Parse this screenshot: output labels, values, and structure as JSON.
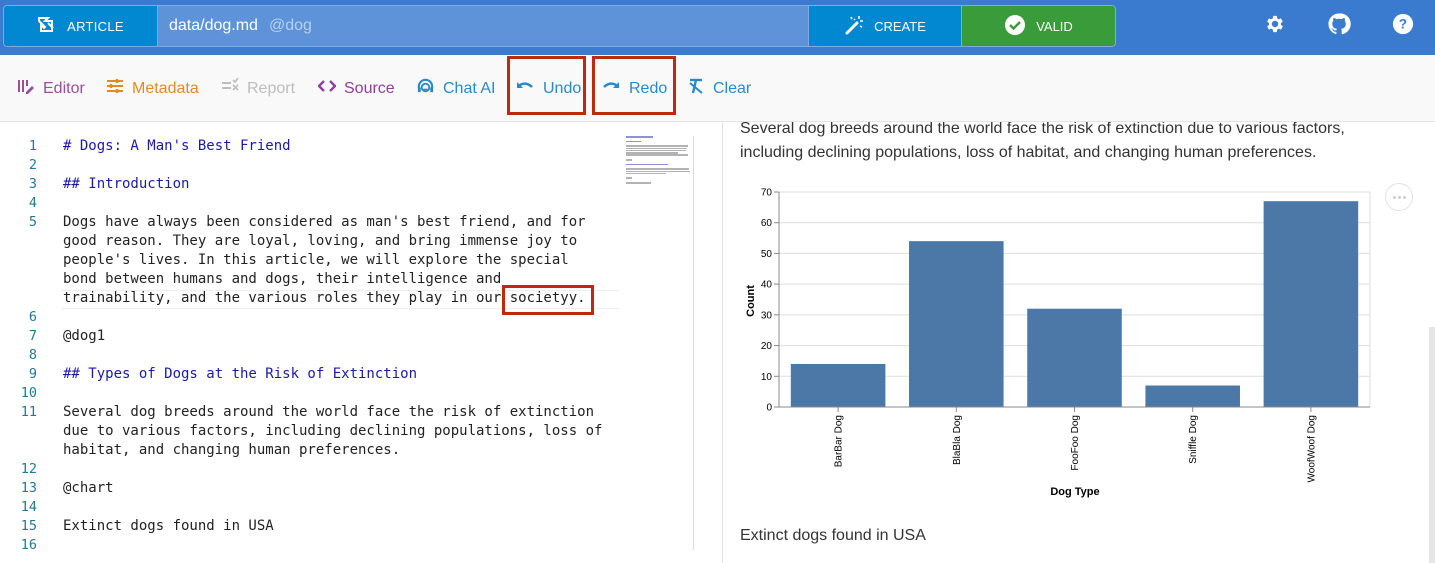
{
  "header": {
    "article_label": "ARTICLE",
    "file_path": "data/dog.md",
    "alias": "@dog",
    "create_label": "CREATE",
    "valid_label": "VALID",
    "icons": [
      "settings-gear-icon",
      "github-icon",
      "help-icon"
    ]
  },
  "toolbar": {
    "editor": "Editor",
    "metadata": "Metadata",
    "report": "Report",
    "source": "Source",
    "chat_ai": "Chat AI",
    "undo": "Undo",
    "redo": "Redo",
    "clear": "Clear",
    "colors": {
      "editor": "#9c4d9c",
      "metadata": "#e08a2a",
      "report": "#bdbdbd",
      "source": "#8e3fa0",
      "actions": "#2a8ac7",
      "highlight": "#c0280f"
    }
  },
  "editor": {
    "lines": [
      {
        "n": "1",
        "text": "# Dogs: A Man's Best Friend",
        "heading": true
      },
      {
        "n": "2",
        "text": ""
      },
      {
        "n": "3",
        "text": "## Introduction",
        "heading": true
      },
      {
        "n": "4",
        "text": ""
      },
      {
        "n": "5",
        "text": "Dogs have always been considered as man's best friend, and for"
      },
      {
        "n": "",
        "text": "good reason. They are loyal, loving, and bring immense joy to"
      },
      {
        "n": "",
        "text": "people's lives. In this article, we will explore the special"
      },
      {
        "n": "",
        "text": "bond between humans and dogs, their intelligence and"
      },
      {
        "n": "",
        "text": "trainability, and the various roles they play in our societyy."
      },
      {
        "n": "6",
        "text": ""
      },
      {
        "n": "7",
        "text": "@dog1"
      },
      {
        "n": "8",
        "text": ""
      },
      {
        "n": "9",
        "text": "## Types of Dogs at the Risk of Extinction",
        "heading": true
      },
      {
        "n": "10",
        "text": ""
      },
      {
        "n": "11",
        "text": "Several dog breeds around the world face the risk of extinction"
      },
      {
        "n": "",
        "text": "due to various factors, including declining populations, loss of"
      },
      {
        "n": "",
        "text": "habitat, and changing human preferences."
      },
      {
        "n": "12",
        "text": ""
      },
      {
        "n": "13",
        "text": "@chart"
      },
      {
        "n": "14",
        "text": ""
      },
      {
        "n": "15",
        "text": "Extinct dogs found in USA"
      },
      {
        "n": "16",
        "text": ""
      }
    ],
    "highlighted_word": "societyy."
  },
  "preview": {
    "paragraph1": "Several dog breeds around the world face the risk of extinction due to various factors, including declining populations, loss of habitat, and changing human preferences.",
    "paragraph2": "Extinct dogs found in USA"
  },
  "chart_data": {
    "type": "bar",
    "categories": [
      "BarBar Dog",
      "BlaBla Dog",
      "FooFoo Dog",
      "Sniffle Dog",
      "WoofWoof Dog"
    ],
    "values": [
      14,
      54,
      32,
      7,
      67
    ],
    "title": "",
    "xlabel": "Dog Type",
    "ylabel": "Count",
    "ylim": [
      0,
      70
    ],
    "yticks": [
      0,
      10,
      20,
      30,
      40,
      50,
      60,
      70
    ],
    "grid": true,
    "bar_color": "#4c78a8"
  }
}
